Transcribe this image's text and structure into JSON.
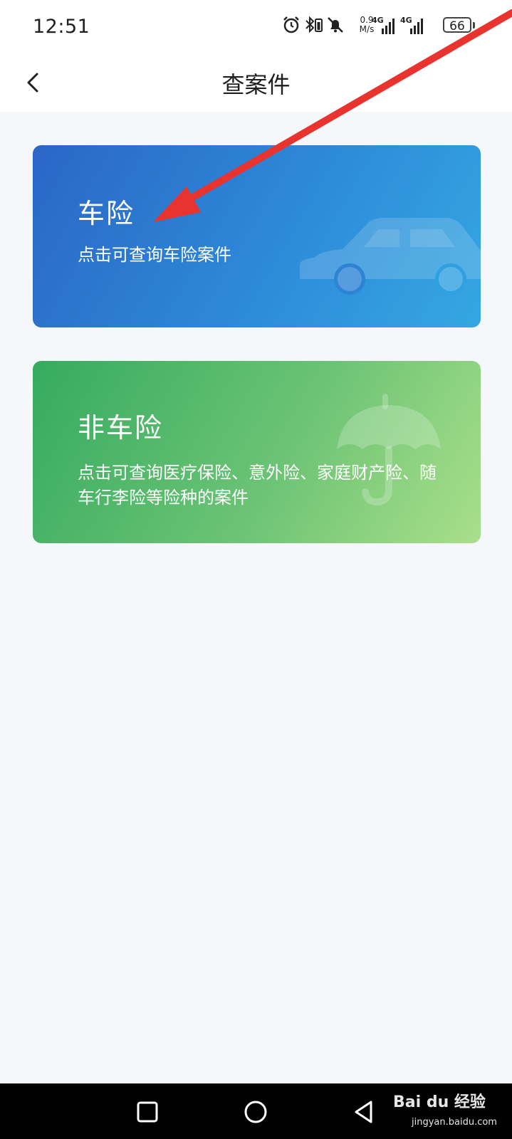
{
  "status_bar": {
    "time": "12:51",
    "net_speed_value": "0.9",
    "net_speed_unit": "M/s",
    "signal1_label": "4G",
    "signal2_label": "4G",
    "battery": "66"
  },
  "header": {
    "title": "查案件"
  },
  "cards": [
    {
      "title": "车险",
      "description": "点击可查询车险案件",
      "icon": "car-icon"
    },
    {
      "title": "非车险",
      "description": "点击可查询医疗保险、意外险、家庭财产险、随车行李险等险种的案件",
      "icon": "umbrella-icon"
    }
  ],
  "system_nav": {
    "recent": "square-icon",
    "home": "circle-icon",
    "back": "triangle-back-icon"
  },
  "watermark": {
    "brand": "Bai du 经验",
    "url": "jingyan.baidu.com"
  },
  "colors": {
    "car_card_start": "#2b66c6",
    "car_card_end": "#35a7e2",
    "noncar_card_start": "#35ab5f",
    "noncar_card_end": "#a9df8a",
    "annotation_arrow": "#e8332f"
  }
}
